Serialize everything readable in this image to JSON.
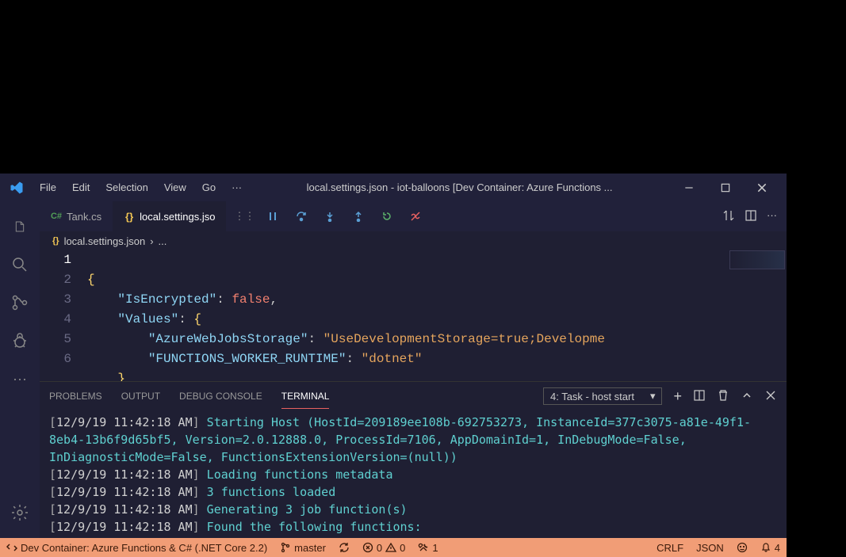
{
  "menu": [
    "File",
    "Edit",
    "Selection",
    "View",
    "Go"
  ],
  "title": "local.settings.json - iot-balloons [Dev Container: Azure Functions ...",
  "tabs": [
    {
      "label": "Tank.cs",
      "icon": "csharp"
    },
    {
      "label": "local.settings.jso",
      "icon": "json"
    }
  ],
  "breadcrumb": {
    "file": "local.settings.json",
    "rest": "..."
  },
  "gutter": [
    "1",
    "2",
    "3",
    "4",
    "5",
    "6"
  ],
  "code": {
    "l1_brace": "{",
    "l2_key": "\"IsEncrypted\"",
    "l2_colon": ": ",
    "l2_val": "false",
    "l2_comma": ",",
    "l3_key": "\"Values\"",
    "l3_colon": ": ",
    "l3_brace": "{",
    "l4_key": "\"AzureWebJobsStorage\"",
    "l4_colon": ": ",
    "l4_val": "\"UseDevelopmentStorage=true;Developme",
    "l5_key": "\"FUNCTIONS_WORKER_RUNTIME\"",
    "l5_colon": ": ",
    "l5_val": "\"dotnet\"",
    "l6_brace": "}"
  },
  "panel": {
    "tabs": [
      "PROBLEMS",
      "OUTPUT",
      "DEBUG CONSOLE",
      "TERMINAL"
    ],
    "selector": "4: Task - host start"
  },
  "terminal": {
    "lines": [
      {
        "ts": "[12/9/19 11:42:18 AM]",
        "msg": "Starting Host (HostId=209189ee108b-692753273, InstanceId=377c3075-a81e-49f1-8eb4-13b6f9d65bf5, Version=2.0.12888.0, ProcessId=7106, AppDomainId=1, InDebugMode=False, InDiagnosticMode=False, FunctionsExtensionVersion=(null))"
      },
      {
        "ts": "[12/9/19 11:42:18 AM]",
        "msg": "Loading functions metadata"
      },
      {
        "ts": "[12/9/19 11:42:18 AM]",
        "msg": "3 functions loaded"
      },
      {
        "ts": "[12/9/19 11:42:18 AM]",
        "msg": "Generating 3 job function(s)"
      },
      {
        "ts": "[12/9/19 11:42:18 AM]",
        "msg": "Found the following functions:"
      }
    ]
  },
  "status": {
    "remote": "Dev Container: Azure Functions & C# (.NET Core 2.2)",
    "branch": "master",
    "errors": "0",
    "warnings": "0",
    "tools": "1",
    "eol": "CRLF",
    "lang": "JSON",
    "notifications": "4"
  }
}
